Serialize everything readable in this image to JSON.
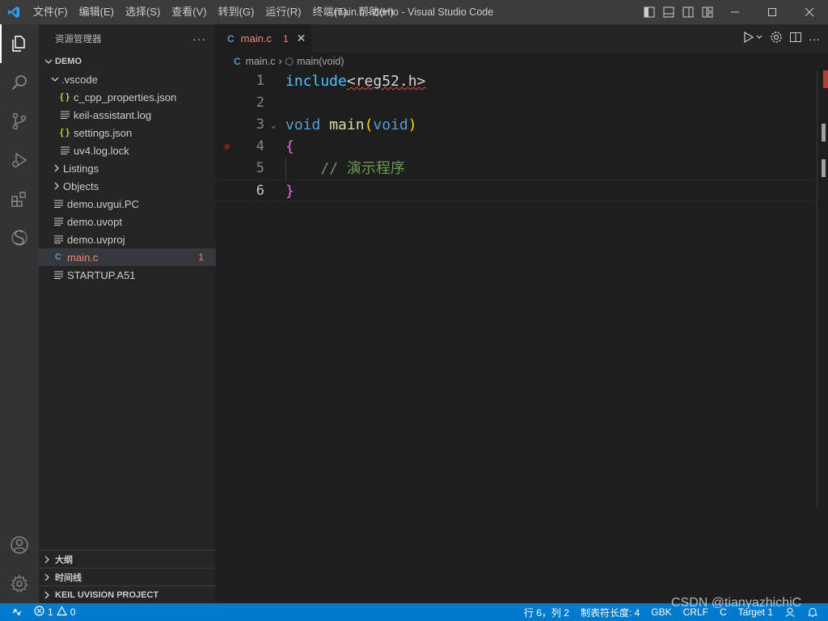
{
  "window": {
    "title": "main.c - demo - Visual Studio Code",
    "menu": [
      "文件(F)",
      "编辑(E)",
      "选择(S)",
      "查看(V)",
      "转到(G)",
      "运行(R)",
      "终端(T)",
      "帮助(H)"
    ]
  },
  "sidebar": {
    "title": "资源管理器",
    "more": "···",
    "root": "DEMO",
    "items": [
      {
        "label": ".vscode",
        "type": "folder-open"
      },
      {
        "label": "c_cpp_properties.json",
        "type": "json"
      },
      {
        "label": "keil-assistant.log",
        "type": "file"
      },
      {
        "label": "settings.json",
        "type": "json"
      },
      {
        "label": "uv4.log.lock",
        "type": "file"
      },
      {
        "label": "Listings",
        "type": "folder"
      },
      {
        "label": "Objects",
        "type": "folder"
      },
      {
        "label": "demo.uvgui.PC",
        "type": "file"
      },
      {
        "label": "demo.uvopt",
        "type": "file"
      },
      {
        "label": "demo.uvproj",
        "type": "file"
      },
      {
        "label": "main.c",
        "type": "c",
        "badge": "1"
      },
      {
        "label": "STARTUP.A51",
        "type": "file"
      }
    ],
    "panels": [
      "大纲",
      "时间线",
      "KEIL UVISION PROJECT"
    ]
  },
  "editor": {
    "tab": {
      "label": "main.c",
      "problems": "1",
      "icon": "C"
    },
    "breadcrumb": {
      "file": "main.c",
      "symbol": "main(void)"
    },
    "lines": [
      {
        "num": "1",
        "tokens": [
          [
            "include",
            "inc squiggle-start"
          ],
          [
            "<reg52.h>",
            "plain"
          ]
        ]
      },
      {
        "num": "2",
        "tokens": []
      },
      {
        "num": "3",
        "tokens": [
          [
            "void",
            "kw"
          ],
          [
            " ",
            "plain"
          ],
          [
            "main",
            "fn"
          ],
          [
            "(",
            "brace"
          ],
          [
            "void",
            "kw"
          ],
          [
            ")",
            "brace"
          ]
        ]
      },
      {
        "num": "4",
        "tokens": [
          [
            "{",
            "paren"
          ]
        ]
      },
      {
        "num": "5",
        "tokens": [
          [
            "    ",
            "plain"
          ],
          [
            "// 演示程序",
            "cmt"
          ]
        ]
      },
      {
        "num": "6",
        "tokens": [
          [
            "}",
            "paren"
          ]
        ]
      }
    ]
  },
  "status": {
    "errors": "1",
    "warnings": "0",
    "position": "行 6，列 2",
    "tab_size": "制表符长度: 4",
    "encoding": "GBK",
    "eol": "CRLF",
    "language": "C",
    "target": "Target 1"
  },
  "watermark": "CSDN @tianyazhichiC",
  "colors": {
    "accent": "#007acc",
    "error": "#f48771"
  }
}
